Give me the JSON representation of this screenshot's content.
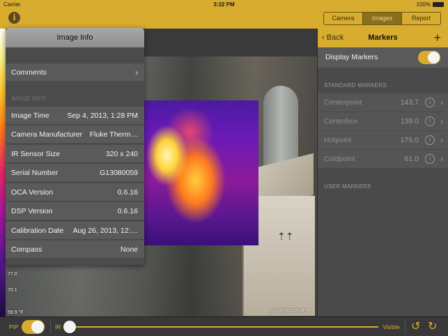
{
  "status_bar": {
    "carrier": "Carrier",
    "time": "3:32 PM",
    "battery": "100%"
  },
  "tabs": [
    {
      "label": "Camera"
    },
    {
      "label": "Images"
    },
    {
      "label": "Report"
    }
  ],
  "active_tab": "Images",
  "image_info": {
    "title": "Image Info",
    "comments_label": "Comments",
    "section_label": "IMAGE INFO",
    "rows": [
      {
        "label": "Image Time",
        "value": "Sep 4, 2013, 1:28 PM"
      },
      {
        "label": "Camera Manufacturer",
        "value": "Fluke Therm…"
      },
      {
        "label": "IR Sensor Size",
        "value": "320 x 240"
      },
      {
        "label": "Serial Number",
        "value": "G13080059"
      },
      {
        "label": "OCA Version",
        "value": "0.6.16"
      },
      {
        "label": "DSP Version",
        "value": "0.6.16"
      },
      {
        "label": "Calibration Date",
        "value": "Aug 26, 2013, 12:…"
      },
      {
        "label": "Compass",
        "value": "None"
      }
    ]
  },
  "scale": {
    "mid_high": "77.0",
    "mid_low": "70.1",
    "min": "59.9 °F"
  },
  "emissivity_text": "ε=0.95   BG=71.6 °F",
  "markers_panel": {
    "back_label": "Back",
    "title": "Markers",
    "add_icon": "plus-icon",
    "display_markers_label": "Display Markers",
    "display_markers_on": true,
    "standard_header": "STANDARD MARKERS",
    "standard": [
      {
        "label": "Centerpoint",
        "value": "143.7"
      },
      {
        "label": "Centerbox",
        "value": "139.0"
      },
      {
        "label": "Hotpoint",
        "value": "176.0"
      },
      {
        "label": "Coldpoint",
        "value": "61.0"
      }
    ],
    "user_header": "USER MARKERS"
  },
  "bottom_bar": {
    "pip_label": "PIP",
    "pip_on": true,
    "ir_label": "IR",
    "visible_label": "Visible",
    "blend_fraction": 0.0
  },
  "colors": {
    "accent": "#d8ac2e",
    "panel": "#4a4a4a",
    "row": "#5a5a5a"
  }
}
